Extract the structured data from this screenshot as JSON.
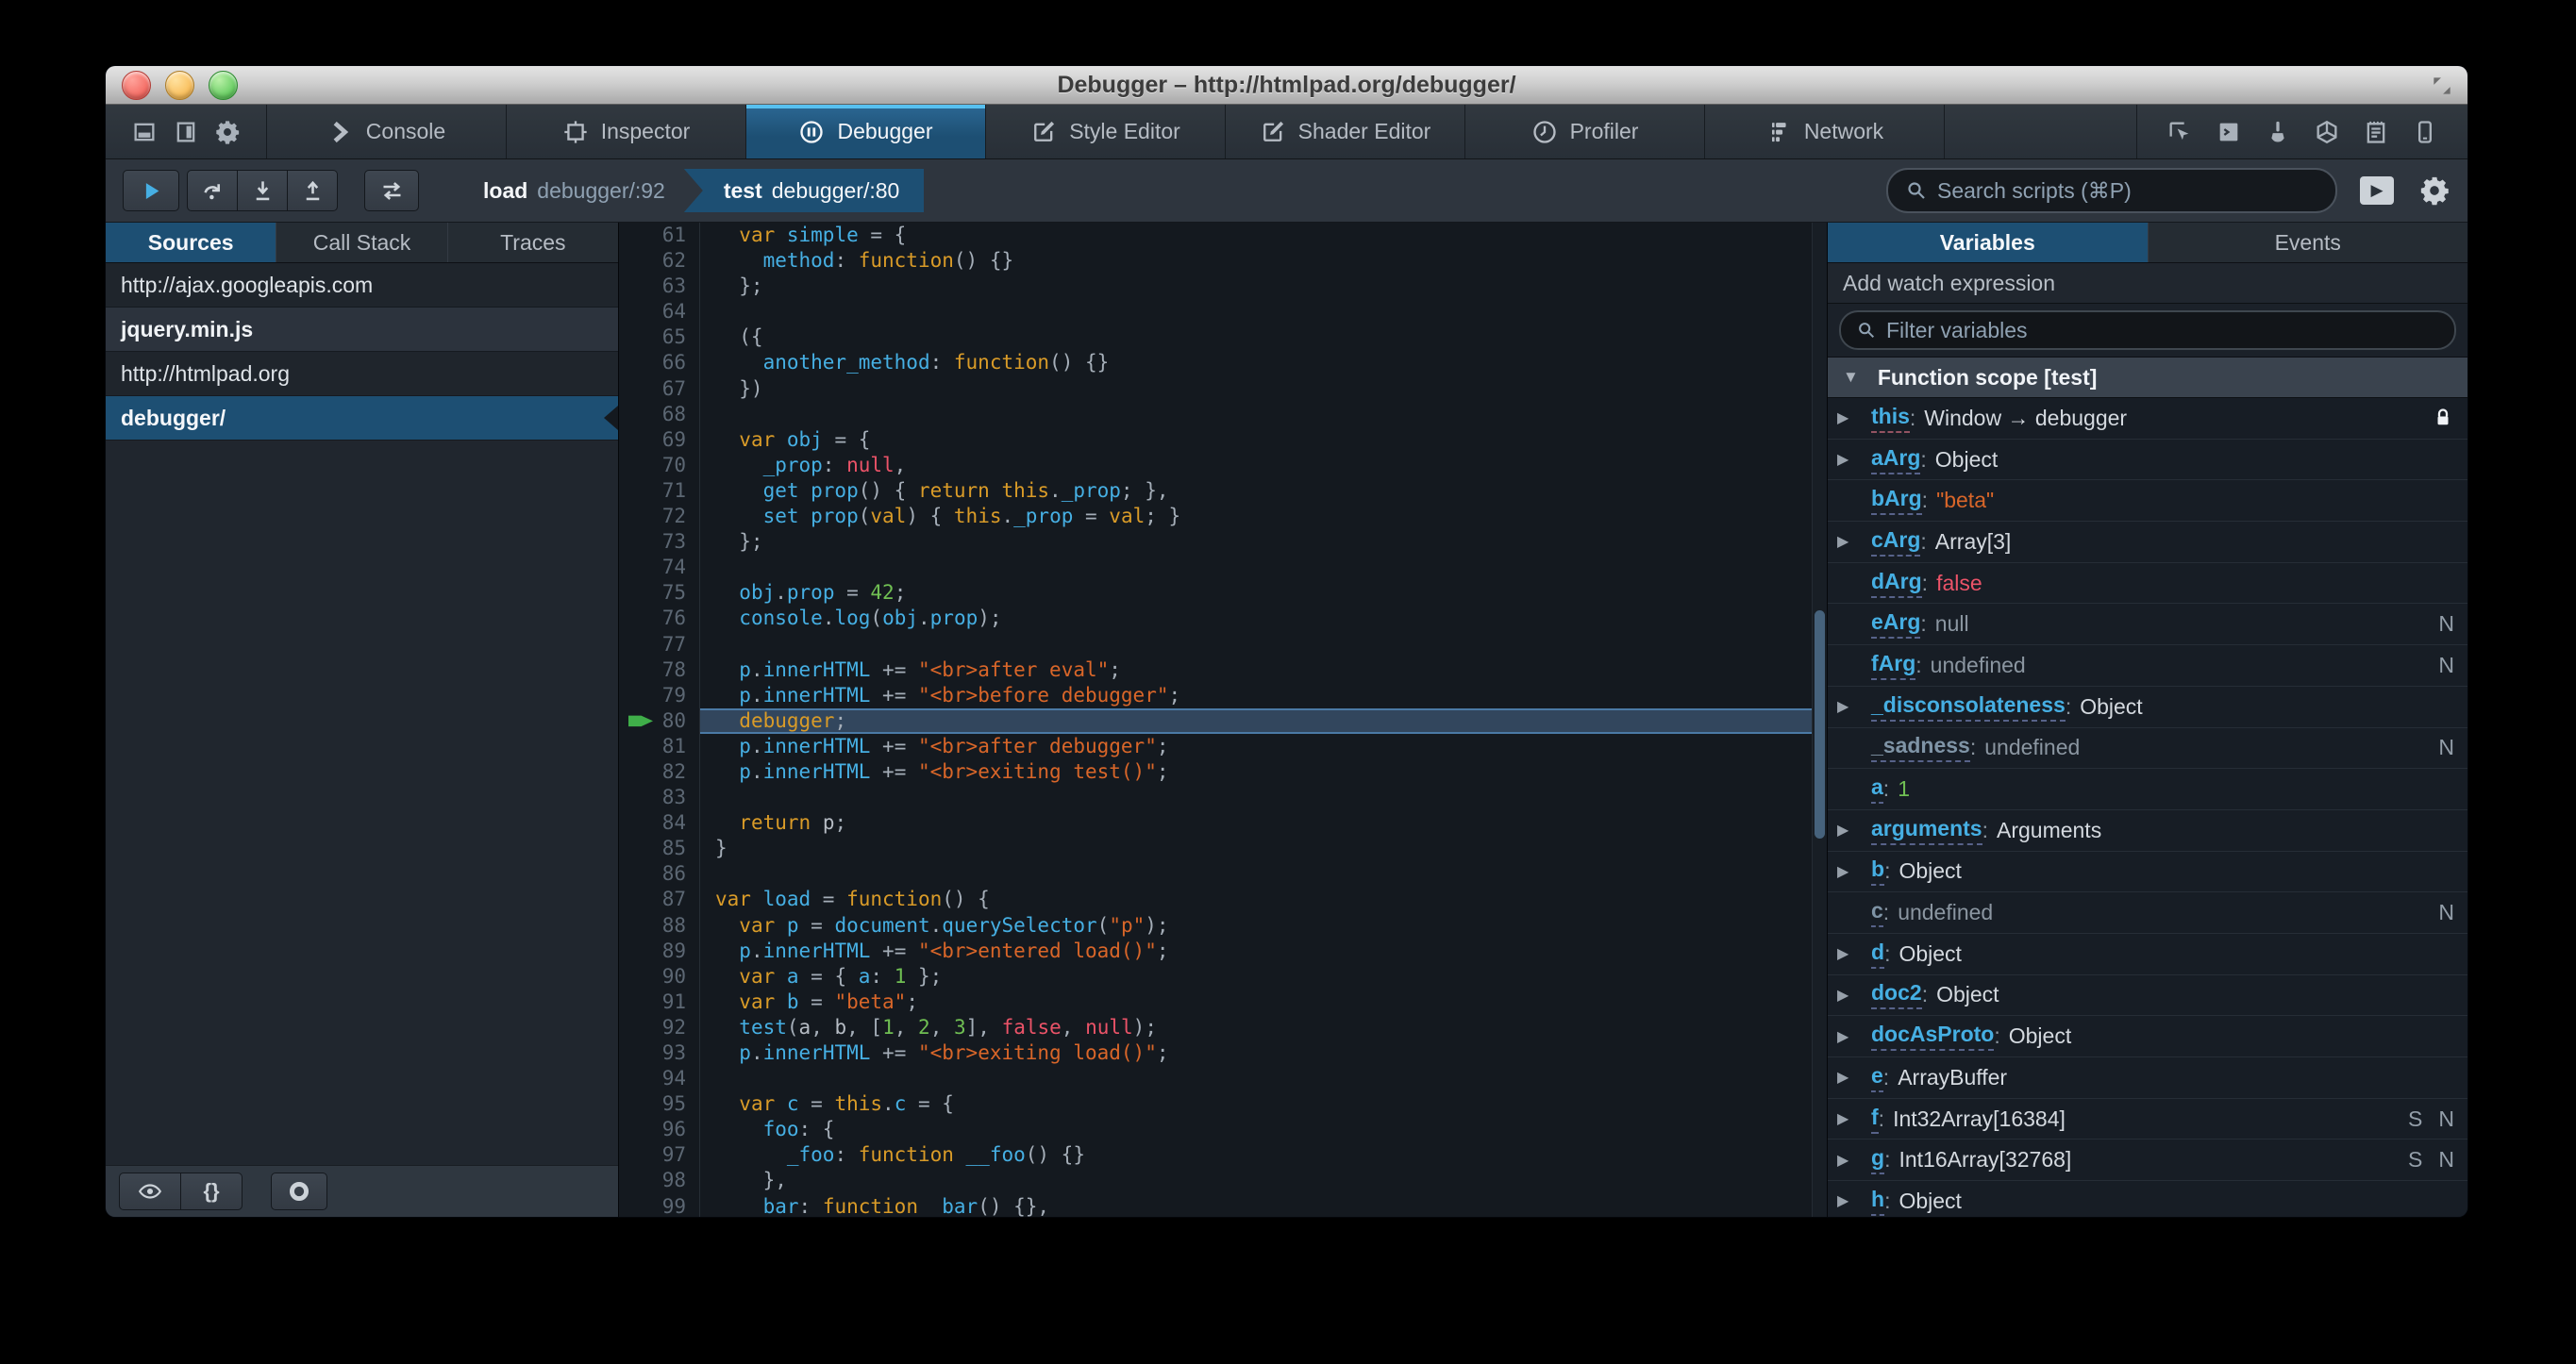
{
  "titlebar": {
    "title": "Debugger – http://htmlpad.org/debugger/"
  },
  "toolbar": {
    "left_icons": [
      {
        "name": "dock-bottom-icon",
        "icon": "dockbottom"
      },
      {
        "name": "dock-side-icon",
        "icon": "dockside"
      },
      {
        "name": "toolbox-options-gear-icon",
        "icon": "gear"
      }
    ],
    "tabs": [
      {
        "label": "Console",
        "icon": "chevron",
        "active": false
      },
      {
        "label": "Inspector",
        "icon": "inspector",
        "active": false
      },
      {
        "label": "Debugger",
        "icon": "pausecircle",
        "active": true
      },
      {
        "label": "Style Editor",
        "icon": "pencil",
        "active": false
      },
      {
        "label": "Shader Editor",
        "icon": "pencil",
        "active": false
      },
      {
        "label": "Profiler",
        "icon": "clock",
        "active": false
      },
      {
        "label": "Network",
        "icon": "network",
        "active": false
      }
    ],
    "right_icons": [
      {
        "name": "element-picker-icon",
        "icon": "picker"
      },
      {
        "name": "split-console-icon",
        "icon": "splitconsole"
      },
      {
        "name": "paintbrush-icon",
        "icon": "brush"
      },
      {
        "name": "tilt-3d-icon",
        "icon": "cube"
      },
      {
        "name": "scratchpad-icon",
        "icon": "scratchpad"
      },
      {
        "name": "responsive-mode-icon",
        "icon": "responsive"
      }
    ]
  },
  "debugger_toolbar": {
    "buttons": [
      {
        "name": "resume-button",
        "icon": "play"
      },
      {
        "name": "step-over-button",
        "icon": "stepover"
      },
      {
        "name": "step-in-button",
        "icon": "stepin"
      },
      {
        "name": "step-out-button",
        "icon": "stepout"
      },
      {
        "name": "toggle-breakpoints-button",
        "icon": "togglebp"
      }
    ],
    "breadcrumbs": [
      {
        "fn": "load",
        "loc": "debugger/:92",
        "active": false
      },
      {
        "fn": "test",
        "loc": "debugger/:80",
        "active": true
      }
    ],
    "search_placeholder": "Search scripts (⌘P)"
  },
  "sources": {
    "tabs": [
      {
        "label": "Sources",
        "active": true
      },
      {
        "label": "Call Stack",
        "active": false
      },
      {
        "label": "Traces",
        "active": false
      }
    ],
    "items": [
      {
        "label": "http://ajax.googleapis.com",
        "kind": "origin",
        "selected": false
      },
      {
        "label": "jquery.min.js",
        "kind": "file",
        "selected": false
      },
      {
        "label": "http://htmlpad.org",
        "kind": "origin",
        "selected": false
      },
      {
        "label": "debugger/",
        "kind": "file",
        "selected": true
      }
    ],
    "footer": {
      "blackbox_label": "blackbox-source",
      "prettyprint_label": "{}",
      "record_label": "toggle-tracing"
    }
  },
  "editor": {
    "current_line": 80,
    "lines": [
      {
        "n": 61,
        "s": [
          [
            "p",
            "  "
          ],
          [
            "k",
            "var "
          ],
          [
            "i",
            "simple"
          ],
          [
            "p",
            " = {"
          ]
        ]
      },
      {
        "n": 62,
        "s": [
          [
            "p",
            "    "
          ],
          [
            "i",
            "method"
          ],
          [
            "p",
            ": "
          ],
          [
            "k",
            "function"
          ],
          [
            "p",
            "() {}"
          ]
        ]
      },
      {
        "n": 63,
        "s": [
          [
            "p",
            "  };"
          ]
        ]
      },
      {
        "n": 64,
        "s": []
      },
      {
        "n": 65,
        "s": [
          [
            "p",
            "  ({"
          ]
        ]
      },
      {
        "n": 66,
        "s": [
          [
            "p",
            "    "
          ],
          [
            "i",
            "another_method"
          ],
          [
            "p",
            ": "
          ],
          [
            "k",
            "function"
          ],
          [
            "p",
            "() {}"
          ]
        ]
      },
      {
        "n": 67,
        "s": [
          [
            "p",
            "  })"
          ]
        ]
      },
      {
        "n": 68,
        "s": []
      },
      {
        "n": 69,
        "s": [
          [
            "p",
            "  "
          ],
          [
            "k",
            "var "
          ],
          [
            "i",
            "obj"
          ],
          [
            "p",
            " = {"
          ]
        ]
      },
      {
        "n": 70,
        "s": [
          [
            "p",
            "    "
          ],
          [
            "i",
            "_prop"
          ],
          [
            "p",
            ": "
          ],
          [
            "a",
            "null"
          ],
          [
            "p",
            ","
          ]
        ]
      },
      {
        "n": 71,
        "s": [
          [
            "p",
            "    "
          ],
          [
            "i",
            "get prop"
          ],
          [
            "p",
            "() { "
          ],
          [
            "k",
            "return "
          ],
          [
            "k",
            "this"
          ],
          [
            "p",
            "."
          ],
          [
            "i",
            "_prop"
          ],
          [
            "p",
            "; },"
          ]
        ]
      },
      {
        "n": 72,
        "s": [
          [
            "p",
            "    "
          ],
          [
            "i",
            "set prop"
          ],
          [
            "p",
            "("
          ],
          [
            "k",
            "val"
          ],
          [
            "p",
            ") { "
          ],
          [
            "k",
            "this"
          ],
          [
            "p",
            "."
          ],
          [
            "i",
            "_prop"
          ],
          [
            "p",
            " = "
          ],
          [
            "k",
            "val"
          ],
          [
            "p",
            "; }"
          ]
        ]
      },
      {
        "n": 73,
        "s": [
          [
            "p",
            "  };"
          ]
        ]
      },
      {
        "n": 74,
        "s": []
      },
      {
        "n": 75,
        "s": [
          [
            "p",
            "  "
          ],
          [
            "i",
            "obj"
          ],
          [
            "p",
            "."
          ],
          [
            "i",
            "prop"
          ],
          [
            "p",
            " = "
          ],
          [
            "n",
            "42"
          ],
          [
            "p",
            ";"
          ]
        ]
      },
      {
        "n": 76,
        "s": [
          [
            "p",
            "  "
          ],
          [
            "i",
            "console"
          ],
          [
            "p",
            "."
          ],
          [
            "i",
            "log"
          ],
          [
            "p",
            "("
          ],
          [
            "i",
            "obj"
          ],
          [
            "p",
            "."
          ],
          [
            "i",
            "prop"
          ],
          [
            "p",
            ");"
          ]
        ]
      },
      {
        "n": 77,
        "s": []
      },
      {
        "n": 78,
        "s": [
          [
            "p",
            "  "
          ],
          [
            "i",
            "p"
          ],
          [
            "p",
            "."
          ],
          [
            "i",
            "innerHTML"
          ],
          [
            "p",
            " += "
          ],
          [
            "s",
            "\"<br>after eval\""
          ],
          [
            "p",
            ";"
          ]
        ]
      },
      {
        "n": 79,
        "s": [
          [
            "p",
            "  "
          ],
          [
            "i",
            "p"
          ],
          [
            "p",
            "."
          ],
          [
            "i",
            "innerHTML"
          ],
          [
            "p",
            " += "
          ],
          [
            "s",
            "\"<br>before debugger\""
          ],
          [
            "p",
            ";"
          ]
        ]
      },
      {
        "n": 80,
        "s": [
          [
            "p",
            "  "
          ],
          [
            "k",
            "debugger"
          ],
          [
            "p",
            ";"
          ]
        ]
      },
      {
        "n": 81,
        "s": [
          [
            "p",
            "  "
          ],
          [
            "i",
            "p"
          ],
          [
            "p",
            "."
          ],
          [
            "i",
            "innerHTML"
          ],
          [
            "p",
            " += "
          ],
          [
            "s",
            "\"<br>after debugger\""
          ],
          [
            "p",
            ";"
          ]
        ]
      },
      {
        "n": 82,
        "s": [
          [
            "p",
            "  "
          ],
          [
            "i",
            "p"
          ],
          [
            "p",
            "."
          ],
          [
            "i",
            "innerHTML"
          ],
          [
            "p",
            " += "
          ],
          [
            "s",
            "\"<br>exiting test()\""
          ],
          [
            "p",
            ";"
          ]
        ]
      },
      {
        "n": 83,
        "s": []
      },
      {
        "n": 84,
        "s": [
          [
            "p",
            "  "
          ],
          [
            "k",
            "return "
          ],
          [
            "t",
            "p"
          ],
          [
            "p",
            ";"
          ]
        ]
      },
      {
        "n": 85,
        "s": [
          [
            "p",
            "}"
          ]
        ]
      },
      {
        "n": 86,
        "s": []
      },
      {
        "n": 87,
        "s": [
          [
            "k",
            "var "
          ],
          [
            "i",
            "load"
          ],
          [
            "p",
            " = "
          ],
          [
            "k",
            "function"
          ],
          [
            "p",
            "() {"
          ]
        ]
      },
      {
        "n": 88,
        "s": [
          [
            "p",
            "  "
          ],
          [
            "k",
            "var "
          ],
          [
            "i",
            "p"
          ],
          [
            "p",
            " = "
          ],
          [
            "i",
            "document"
          ],
          [
            "p",
            "."
          ],
          [
            "i",
            "querySelector"
          ],
          [
            "p",
            "("
          ],
          [
            "s",
            "\"p\""
          ],
          [
            "p",
            ");"
          ]
        ]
      },
      {
        "n": 89,
        "s": [
          [
            "p",
            "  "
          ],
          [
            "i",
            "p"
          ],
          [
            "p",
            "."
          ],
          [
            "i",
            "innerHTML"
          ],
          [
            "p",
            " += "
          ],
          [
            "s",
            "\"<br>entered load()\""
          ],
          [
            "p",
            ";"
          ]
        ]
      },
      {
        "n": 90,
        "s": [
          [
            "p",
            "  "
          ],
          [
            "k",
            "var "
          ],
          [
            "i",
            "a"
          ],
          [
            "p",
            " = { "
          ],
          [
            "i",
            "a"
          ],
          [
            "p",
            ": "
          ],
          [
            "n",
            "1"
          ],
          [
            "p",
            " };"
          ]
        ]
      },
      {
        "n": 91,
        "s": [
          [
            "p",
            "  "
          ],
          [
            "k",
            "var "
          ],
          [
            "i",
            "b"
          ],
          [
            "p",
            " = "
          ],
          [
            "s",
            "\"beta\""
          ],
          [
            "p",
            ";"
          ]
        ]
      },
      {
        "n": 92,
        "s": [
          [
            "p",
            "  "
          ],
          [
            "i",
            "test"
          ],
          [
            "p",
            "("
          ],
          [
            "t",
            "a"
          ],
          [
            "p",
            ", "
          ],
          [
            "t",
            "b"
          ],
          [
            "p",
            ", ["
          ],
          [
            "n",
            "1"
          ],
          [
            "p",
            ", "
          ],
          [
            "n",
            "2"
          ],
          [
            "p",
            ", "
          ],
          [
            "n",
            "3"
          ],
          [
            "p",
            "], "
          ],
          [
            "a",
            "false"
          ],
          [
            "p",
            ", "
          ],
          [
            "a",
            "null"
          ],
          [
            "p",
            ");"
          ]
        ]
      },
      {
        "n": 93,
        "s": [
          [
            "p",
            "  "
          ],
          [
            "i",
            "p"
          ],
          [
            "p",
            "."
          ],
          [
            "i",
            "innerHTML"
          ],
          [
            "p",
            " += "
          ],
          [
            "s",
            "\"<br>exiting load()\""
          ],
          [
            "p",
            ";"
          ]
        ]
      },
      {
        "n": 94,
        "s": []
      },
      {
        "n": 95,
        "s": [
          [
            "p",
            "  "
          ],
          [
            "k",
            "var "
          ],
          [
            "i",
            "c"
          ],
          [
            "p",
            " = "
          ],
          [
            "k",
            "this"
          ],
          [
            "p",
            "."
          ],
          [
            "i",
            "c"
          ],
          [
            "p",
            " = {"
          ]
        ]
      },
      {
        "n": 96,
        "s": [
          [
            "p",
            "    "
          ],
          [
            "i",
            "foo"
          ],
          [
            "p",
            ": {"
          ]
        ]
      },
      {
        "n": 97,
        "s": [
          [
            "p",
            "      "
          ],
          [
            "i",
            "_foo"
          ],
          [
            "p",
            ": "
          ],
          [
            "k",
            "function "
          ],
          [
            "i",
            "__foo"
          ],
          [
            "p",
            "() {}"
          ]
        ]
      },
      {
        "n": 98,
        "s": [
          [
            "p",
            "    },"
          ]
        ]
      },
      {
        "n": 99,
        "s": [
          [
            "p",
            "    "
          ],
          [
            "i",
            "bar"
          ],
          [
            "p",
            ": "
          ],
          [
            "k",
            "function "
          ],
          [
            "i",
            "_bar"
          ],
          [
            "p",
            "() {},"
          ]
        ]
      }
    ]
  },
  "variables": {
    "tabs": [
      {
        "label": "Variables",
        "active": true
      },
      {
        "label": "Events",
        "active": false
      }
    ],
    "watch_label": "Add watch expression",
    "filter_placeholder": "Filter variables",
    "scope_label": "Function scope [test]",
    "rows": [
      {
        "name": "this",
        "value": "Window → debugger",
        "vt": "obj",
        "exp": true,
        "lock": true,
        "underline": "pink",
        "badges": ""
      },
      {
        "name": "aArg",
        "value": "Object",
        "vt": "obj",
        "exp": true,
        "badges": ""
      },
      {
        "name": "bArg",
        "value": "\"beta\"",
        "vt": "str",
        "exp": false,
        "badges": ""
      },
      {
        "name": "cArg",
        "value": "Array[3]",
        "vt": "obj",
        "exp": true,
        "badges": ""
      },
      {
        "name": "dArg",
        "value": "false",
        "vt": "bool",
        "exp": false,
        "badges": ""
      },
      {
        "name": "eArg",
        "value": "null",
        "vt": "void",
        "exp": false,
        "badges": "N"
      },
      {
        "name": "fArg",
        "value": "undefined",
        "vt": "void",
        "exp": false,
        "badges": "N"
      },
      {
        "name": "_disconsolateness",
        "value": "Object",
        "vt": "obj",
        "exp": true,
        "badges": ""
      },
      {
        "name": "_sadness",
        "value": "undefined",
        "vt": "void",
        "exp": false,
        "badges": "N",
        "dim": true
      },
      {
        "name": "a",
        "value": "1",
        "vt": "num",
        "exp": false,
        "badges": ""
      },
      {
        "name": "arguments",
        "value": "Arguments",
        "vt": "obj",
        "exp": true,
        "badges": ""
      },
      {
        "name": "b",
        "value": "Object",
        "vt": "obj",
        "exp": true,
        "badges": ""
      },
      {
        "name": "c",
        "value": "undefined",
        "vt": "void",
        "exp": false,
        "badges": "N",
        "dim": true
      },
      {
        "name": "d",
        "value": "Object",
        "vt": "obj",
        "exp": true,
        "badges": ""
      },
      {
        "name": "doc2",
        "value": "Object",
        "vt": "obj",
        "exp": true,
        "badges": ""
      },
      {
        "name": "docAsProto",
        "value": "Object",
        "vt": "obj",
        "exp": true,
        "badges": ""
      },
      {
        "name": "e",
        "value": "ArrayBuffer",
        "vt": "obj",
        "exp": true,
        "badges": ""
      },
      {
        "name": "f",
        "value": "Int32Array[16384]",
        "vt": "obj",
        "exp": true,
        "badges": "S N"
      },
      {
        "name": "g",
        "value": "Int16Array[32768]",
        "vt": "obj",
        "exp": true,
        "badges": "S N"
      },
      {
        "name": "h",
        "value": "Object",
        "vt": "obj",
        "exp": true,
        "badges": ""
      }
    ]
  },
  "colors": {
    "selection_blue": "#1d4f73",
    "accent_blue": "#46afe3",
    "keyword_tan": "#d99b28",
    "string_orange": "#d96629",
    "number_green": "#70bf53",
    "atom_red": "#eb5368",
    "current_line_bg": "#32465d",
    "arrow_green": "#3fae49",
    "toolbar_bg": "#2e353e",
    "editor_bg": "#14191f"
  }
}
